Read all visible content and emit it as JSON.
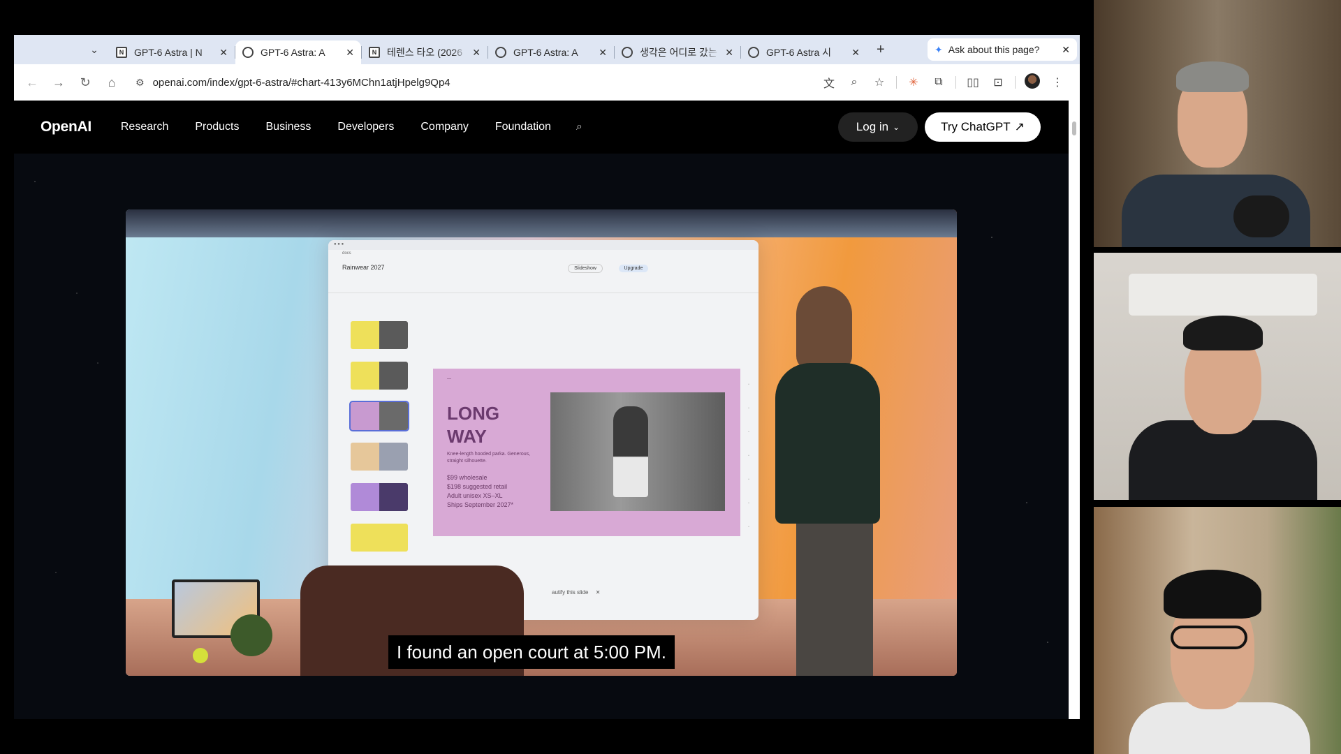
{
  "browser": {
    "tabs": [
      {
        "title": "GPT-6 Astra | N",
        "favicon": "notion",
        "active": false
      },
      {
        "title": "GPT-6 Astra: A",
        "favicon": "openai",
        "active": true
      },
      {
        "title": "테렌스 타오 (2026",
        "favicon": "notion",
        "active": false
      },
      {
        "title": "GPT-6 Astra: A",
        "favicon": "openai",
        "active": false
      },
      {
        "title": "생각은 어디로 갔는",
        "favicon": "globe",
        "active": false
      },
      {
        "title": "GPT-6 Astra 시",
        "favicon": "globe",
        "active": false
      }
    ],
    "ask_label": "Ask about this page?",
    "url": "openai.com/index/gpt-6-astra/#chart-413y6MChn1atjHpelg9Qp4"
  },
  "site": {
    "logo": "OpenAI",
    "nav": [
      "Research",
      "Products",
      "Business",
      "Developers",
      "Company",
      "Foundation"
    ],
    "login_label": "Log in",
    "cta_label": "Try ChatGPT"
  },
  "video": {
    "slide_title_line1": "LONG",
    "slide_title_line2": "WAY",
    "slide_subtitle": "Knee-length hooded parka. Generous, straight silhouette.",
    "prices": [
      "$99 wholesale",
      "$198 suggested retail",
      "Adult unisex XS–XL",
      "Ships September 2027*"
    ],
    "deck_title": "Rainwear 2027",
    "slideshow_label": "Slideshow",
    "upgrade_label": "Upgrade",
    "beautify_label": "autify this slide",
    "caption": "I found an open court at 5:00 PM."
  },
  "colors": {
    "slide_bg": "#d8a9d5",
    "slide_text": "#6b3a6e",
    "cta_bg": "#ffffff",
    "nav_bg": "#000000"
  }
}
